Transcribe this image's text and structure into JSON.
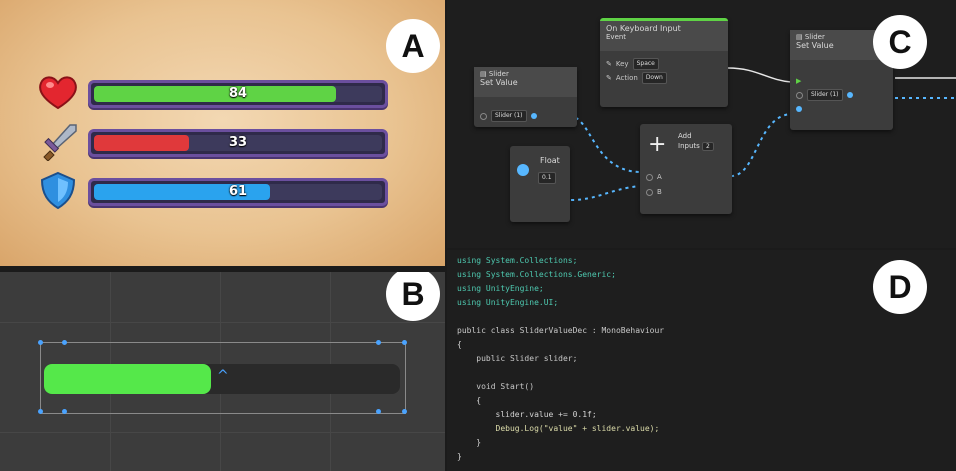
{
  "panels": {
    "a": {
      "label": "A",
      "bars": [
        {
          "stat": "health",
          "icon": "heart-icon",
          "value": "84",
          "fraction": 0.84,
          "fill_color": "#5fd345"
        },
        {
          "stat": "attack",
          "icon": "sword-icon",
          "value": "33",
          "fraction": 0.33,
          "fill_color": "#e0393b"
        },
        {
          "stat": "defense",
          "icon": "shield-icon",
          "value": "61",
          "fraction": 0.61,
          "fill_color": "#2aa3ee"
        }
      ]
    },
    "b": {
      "label": "B",
      "slider_fraction": 0.47,
      "fill_color": "#55e84a"
    },
    "c": {
      "label": "C",
      "nodes": {
        "set_value_1": {
          "category": "Slider",
          "title": "Set Value",
          "target": "Slider (1)"
        },
        "keyboard_input": {
          "title": "On Keyboard Input",
          "subtitle": "Event",
          "key_label": "Key",
          "key_value": "Space",
          "action_label": "Action",
          "action_value": "Down"
        },
        "float": {
          "title": "Float",
          "value": "0.1"
        },
        "add": {
          "title": "Add",
          "inputs_label": "Inputs",
          "inputs_value": "2",
          "port_a": "A",
          "port_b": "B"
        },
        "set_value_2": {
          "category": "Slider",
          "title": "Set Value",
          "target": "Slider (1)"
        }
      }
    },
    "d": {
      "label": "D",
      "code_lines": [
        "using System.Collections;",
        "using System.Collections.Generic;",
        "using UnityEngine;",
        "using UnityEngine.UI;",
        "",
        "public class SliderValueDec : MonoBehaviour",
        "{",
        "    public Slider slider;",
        "",
        "    void Start()",
        "    {",
        "        slider.value += 0.1f;",
        "        Debug.Log(\"value\" + slider.value);",
        "    }",
        "}"
      ]
    }
  }
}
